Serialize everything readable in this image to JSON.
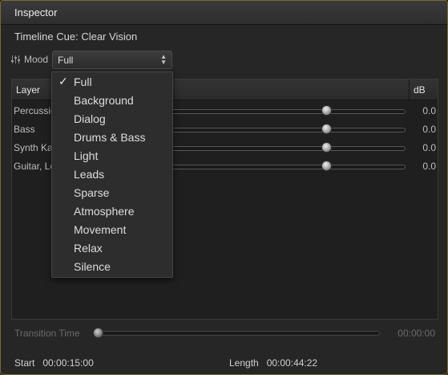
{
  "window": {
    "title": "Inspector"
  },
  "cue": {
    "label": "Timeline Cue: Clear Vision"
  },
  "mood": {
    "label": "Mood",
    "selected": "Full",
    "options": [
      "Full",
      "Background",
      "Dialog",
      "Drums & Bass",
      "Light",
      "Leads",
      "Sparse",
      "Atmosphere",
      "Movement",
      "Relax",
      "Silence"
    ]
  },
  "layers": {
    "header_layer": "Layer",
    "header_db": "dB",
    "rows": [
      {
        "name": "Percussion",
        "db": "0.0",
        "level": 0.77
      },
      {
        "name": "Bass",
        "db": "0.0",
        "level": 0.77
      },
      {
        "name": "Synth Kalimba",
        "db": "0.0",
        "level": 0.77
      },
      {
        "name": "Guitar, Leads",
        "db": "0.0",
        "level": 0.77
      }
    ]
  },
  "transition": {
    "label": "Transition Time",
    "value": "00:00:00",
    "level": 0.0
  },
  "footer": {
    "start_label": "Start",
    "start_value": "00:00:15:00",
    "length_label": "Length",
    "length_value": "00:00:44:22"
  },
  "icons": {
    "mood": "sliders-icon",
    "select_arrows": "up-down-arrows-icon",
    "check": "checkmark-icon"
  }
}
